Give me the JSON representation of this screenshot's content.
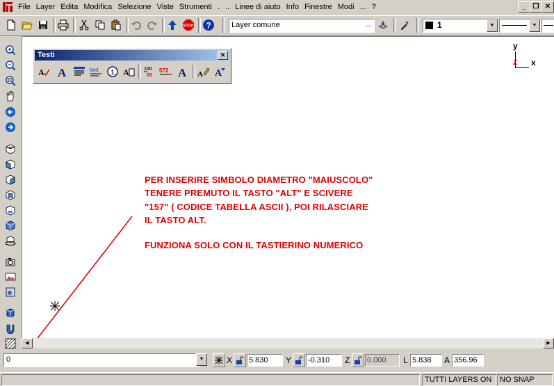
{
  "menu": {
    "items": [
      "File",
      "Layer",
      "Edita",
      "Modifica",
      "Selezione",
      "Viste",
      "Strumenti",
      ".",
      "..",
      "Linee di aiuto",
      "Info",
      "Finestre",
      "Modi",
      "...",
      "?"
    ]
  },
  "window_controls": {
    "minimize": "_",
    "restore": "❐",
    "close": "✕"
  },
  "toolbar": {
    "layer_combo_value": "Layer comune",
    "layer_combo_ellipsis": "...",
    "color_combo_value": "1"
  },
  "testi_toolbar": {
    "title": "Testi",
    "close": "✕"
  },
  "canvas": {
    "ucs": {
      "y_label": "y",
      "z_label": "z",
      "x_label": "x"
    }
  },
  "annotation": {
    "lines": [
      "PER INSERIRE SIMBOLO DIAMETRO \"MAIUSCOLO\"",
      "TENERE  PREMUTO  IL TASTO   \"ALT\"  E  SCIVERE",
      "\"157\" ( CODICE TABELLA ASCII ), POI RILASCIARE",
      "IL TASTO ALT.",
      "FUNZIONA SOLO CON IL TASTIERINO NUMERICO"
    ],
    "color": "#e00000"
  },
  "command_line": {
    "value": "0"
  },
  "coordinates": {
    "x_label": "X",
    "x_value": "5.830",
    "y_label": "Y",
    "y_value": "-0.310",
    "z_label": "Z",
    "z_value": "0.000",
    "l_label": "L",
    "l_value": "5.838",
    "a_label": "A",
    "a_value": "356.96"
  },
  "status": {
    "layers": "TUTTI LAYERS ON",
    "snap": "NO SNAP"
  }
}
